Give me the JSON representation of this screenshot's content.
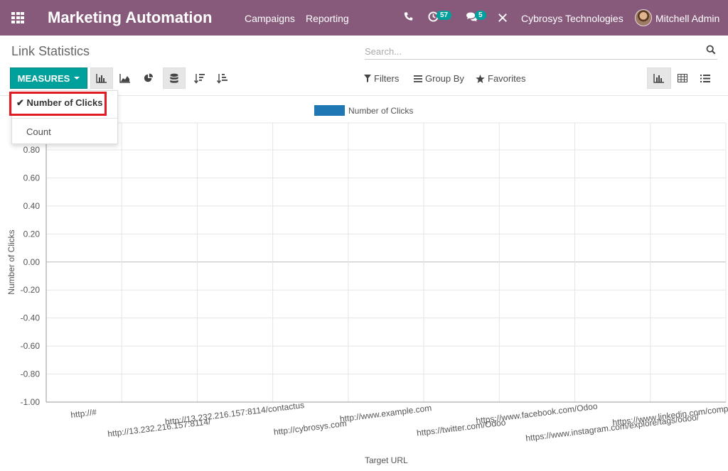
{
  "topbar": {
    "brand": "Marketing Automation",
    "nav": [
      "Campaigns",
      "Reporting"
    ],
    "activity_count": "57",
    "messages_count": "5",
    "company": "Cybrosys Technologies",
    "user": "Mitchell Admin",
    "bg_color": "#875a7b"
  },
  "page": {
    "title": "Link Statistics",
    "search_placeholder": "Search..."
  },
  "toolbar": {
    "measures_label": "MEASURES",
    "filters_label": "Filters",
    "groupby_label": "Group By",
    "favorites_label": "Favorites",
    "accent_color": "#00a09d"
  },
  "measures_menu": {
    "selected": "Number of Clicks",
    "other": "Count"
  },
  "chart_data": {
    "type": "bar",
    "legend": [
      "Number of Clicks"
    ],
    "series": [
      {
        "name": "Number of Clicks",
        "color": "#1f77b4",
        "values": [
          0,
          0,
          0,
          0,
          0,
          0,
          0,
          0,
          0
        ]
      }
    ],
    "categories": [
      "http://#",
      "http://13.232.216.157:8114/",
      "http://13.232.216.157:8114/contactus",
      "http://cybrosys.com",
      "http://www.example.com",
      "https://twitter.com/Odoo",
      "https://www.facebook.com/Odoo",
      "https://www.instagram.com/explore/tags/odoo/",
      "https://www.linkedin.com/company/odoo"
    ],
    "ylim": [
      -1.0,
      1.0
    ],
    "yticks": [
      "0.80",
      "0.60",
      "0.40",
      "0.20",
      "0.00",
      "-0.20",
      "-0.40",
      "-0.60",
      "-0.80",
      "-1.00"
    ],
    "ytick_values": [
      0.8,
      0.6,
      0.4,
      0.2,
      0.0,
      -0.2,
      -0.4,
      -0.6,
      -0.8,
      -1.0
    ],
    "xlabel": "Target URL",
    "ylabel": "Number of Clicks",
    "grid": true,
    "legend_position": "top-center"
  }
}
